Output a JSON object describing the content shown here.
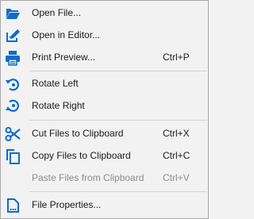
{
  "menu": {
    "colors": {
      "icon": "#0e6cc9",
      "text": "#1a1a1a",
      "disabled_text": "#8d8d8d",
      "background": "#f2f2f2"
    },
    "items": [
      {
        "icon": "folder-open-icon",
        "label": "Open File...",
        "shortcut": ""
      },
      {
        "icon": "edit-in-editor-icon",
        "label": "Open in Editor...",
        "shortcut": ""
      },
      {
        "icon": "printer-icon",
        "label": "Print Preview...",
        "shortcut": "Ctrl+P"
      },
      {
        "icon": "rotate-left-icon",
        "label": "Rotate Left",
        "shortcut": ""
      },
      {
        "icon": "rotate-right-icon",
        "label": "Rotate Right",
        "shortcut": ""
      },
      {
        "icon": "scissors-icon",
        "label": "Cut Files to Clipboard",
        "shortcut": "Ctrl+X"
      },
      {
        "icon": "copy-icon",
        "label": "Copy Files to Clipboard",
        "shortcut": "Ctrl+C"
      },
      {
        "icon": "",
        "label": "Paste Files from Clipboard",
        "shortcut": "Ctrl+V",
        "disabled": true
      },
      {
        "icon": "file-properties-icon",
        "label": "File Properties...",
        "shortcut": ""
      }
    ]
  }
}
